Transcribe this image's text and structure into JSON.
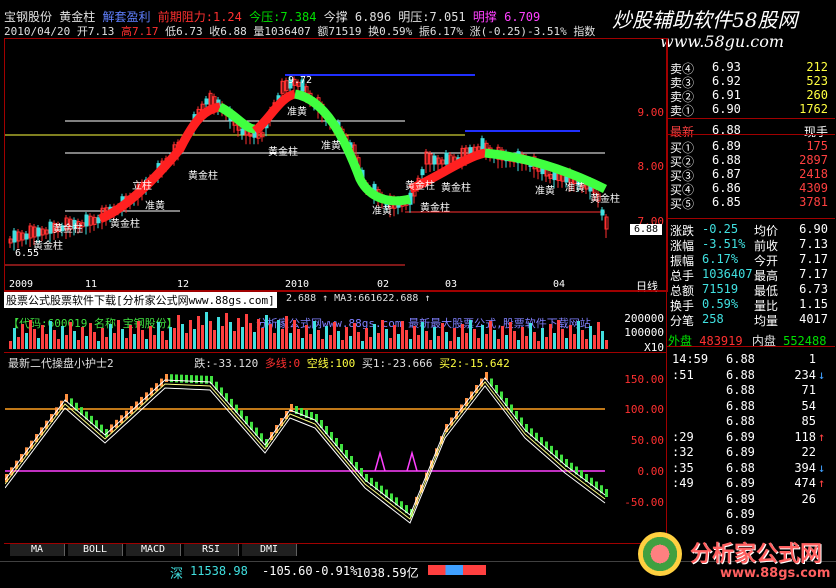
{
  "header": {
    "stock_name": "宝钢股份",
    "indicator_name": "黄金柱",
    "sell_line": "解套盈利",
    "mid_line": "前期阻力:1.24",
    "pressure_line": "今压:7.384",
    "support_line": "今撑 6.896",
    "tomorrow_pressure": "明压:7.051",
    "tomorrow_resist": "明撑 6.709",
    "row2": {
      "date": "2010/04/20",
      "open": "开7.13",
      "high": "高7.17",
      "low": "低6.73",
      "close": "收6.88",
      "volume": "量1036407",
      "amount": "额71519",
      "turnover": "换0.59%",
      "amplitude": "振6.17%",
      "change": "涨(-0.25)-3.51%",
      "index_label": "指数"
    }
  },
  "watermark_top": {
    "title": "炒股辅助软件58股网",
    "url": "www.58gu.com"
  },
  "main_chart": {
    "y_ticks": [
      "9.00",
      "8.00",
      "7.00"
    ],
    "current_price_tag": "6.88",
    "peak_label": "9.72",
    "low_label": "6.55",
    "x_labels": [
      "2009",
      "11",
      "12",
      "2010",
      "02",
      "03",
      "04"
    ],
    "period_label": "日线",
    "annotations": [
      "黄金柱",
      "黄金柱",
      "黄金柱",
      "立柱",
      "准黄",
      "黄金柱",
      "黄金柱",
      "准黄",
      "准黄",
      "黄金柱",
      "黄金柱",
      "准黄",
      "准黄",
      "准黄",
      "黄金柱",
      "黄金柱"
    ]
  },
  "volume_panel": {
    "banner": "股票公式股票软件下载[分析家公式网www.88gs.com]",
    "ma_text": "2.688 ↑ MA3:661622.688 ↑",
    "code_text": "【代码:600019 名称:宝钢股份】",
    "ad_text": "分析家公式网www.88gs.com 最新最大股票公式,股票软件下载网站",
    "y_ticks": [
      "200000",
      "100000",
      "X10"
    ]
  },
  "indicator_panel": {
    "title": "最新二代操盘小护士2",
    "value1": "跌:-33.120",
    "value2": "多线:0",
    "value3": "空线:100",
    "value4": "买1:-23.666",
    "value5": "买2:-15.642",
    "y_ticks": [
      "150.00",
      "100.00",
      "50.00",
      "0.00",
      "-50.00"
    ]
  },
  "tabs": [
    "MA",
    "BOLL",
    "MACD",
    "RSI",
    "DMI"
  ],
  "status_bar": {
    "market": "深",
    "index": "11538.98",
    "change": "-105.60",
    "pct": "-0.91%",
    "amount": "1038.59亿"
  },
  "order_book": {
    "sells": [
      {
        "label": "卖④",
        "price": "6.93",
        "vol": "212"
      },
      {
        "label": "卖③",
        "price": "6.92",
        "vol": "523"
      },
      {
        "label": "卖②",
        "price": "6.91",
        "vol": "260"
      },
      {
        "label": "卖①",
        "price": "6.90",
        "vol": "1762"
      }
    ],
    "last": {
      "label": "最新",
      "price": "6.88",
      "extra": "现手"
    },
    "buys": [
      {
        "label": "买①",
        "price": "6.89",
        "vol": "175"
      },
      {
        "label": "买②",
        "price": "6.88",
        "vol": "2897"
      },
      {
        "label": "买③",
        "price": "6.87",
        "vol": "2418"
      },
      {
        "label": "买④",
        "price": "6.86",
        "vol": "4309"
      },
      {
        "label": "买⑤",
        "price": "6.85",
        "vol": "3781"
      }
    ]
  },
  "stats": [
    {
      "k1": "涨跌",
      "v1": "-0.25",
      "k2": "均价",
      "v2": "6.90"
    },
    {
      "k1": "涨幅",
      "v1": "-3.51%",
      "k2": "前收",
      "v2": "7.13"
    },
    {
      "k1": "振幅",
      "v1": "6.17%",
      "k2": "今开",
      "v2": "7.17"
    },
    {
      "k1": "总手",
      "v1": "1036407",
      "k2": "最高",
      "v2": "7.17"
    },
    {
      "k1": "总额",
      "v1": "71519",
      "k2": "最低",
      "v2": "6.73"
    },
    {
      "k1": "换手",
      "v1": "0.59%",
      "k2": "量比",
      "v2": "1.15"
    },
    {
      "k1": "分笔",
      "v1": "258",
      "k2": "均量",
      "v2": "4017"
    }
  ],
  "outer_inner": {
    "out_label": "外盘",
    "out_val": "483919",
    "in_label": "内盘",
    "in_val": "552488"
  },
  "ticks": [
    {
      "time": "14:59",
      "price": "6.88",
      "vol": "1",
      "arrow": ""
    },
    {
      "time": ":51",
      "price": "6.88",
      "vol": "234",
      "arrow": "↓"
    },
    {
      "time": "",
      "price": "6.88",
      "vol": "71",
      "arrow": ""
    },
    {
      "time": "",
      "price": "6.88",
      "vol": "54",
      "arrow": ""
    },
    {
      "time": "",
      "price": "6.88",
      "vol": "85",
      "arrow": ""
    },
    {
      "time": ":29",
      "price": "6.89",
      "vol": "118",
      "arrow": "↑"
    },
    {
      "time": ":32",
      "price": "6.89",
      "vol": "22",
      "arrow": ""
    },
    {
      "time": ":35",
      "price": "6.88",
      "vol": "394",
      "arrow": "↓"
    },
    {
      "time": ":49",
      "price": "6.89",
      "vol": "474",
      "arrow": "↑"
    },
    {
      "time": "",
      "price": "6.89",
      "vol": "26",
      "arrow": ""
    },
    {
      "time": "",
      "price": "6.89",
      "vol": "",
      "arrow": ""
    },
    {
      "time": "",
      "price": "6.89",
      "vol": "",
      "arrow": ""
    }
  ],
  "watermark_bottom": {
    "title": "分析家公式网",
    "url": "www.88gs.com"
  },
  "colors": {
    "up": "#ff3030",
    "down": "#00e000",
    "border": "#a00000",
    "accent_yellow": "#ffff40"
  }
}
